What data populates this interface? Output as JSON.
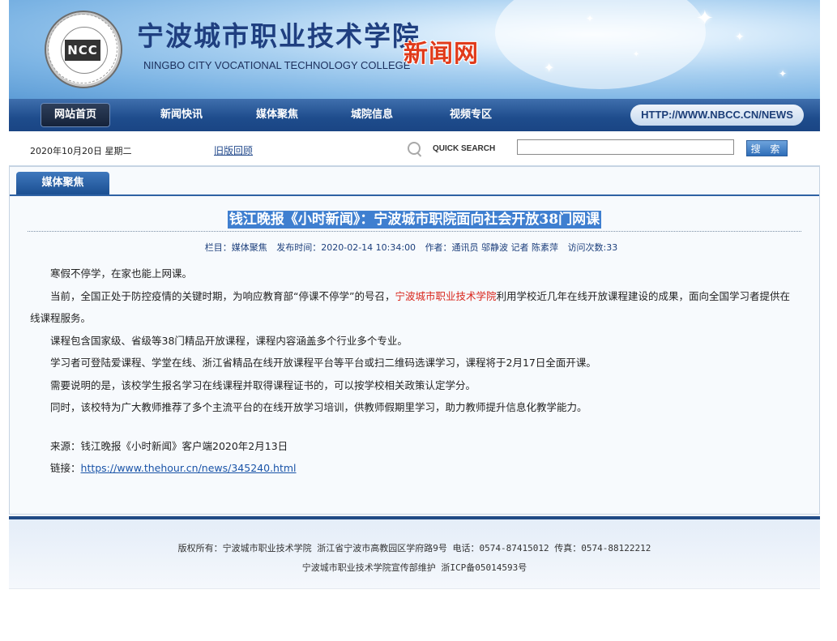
{
  "header": {
    "title_cn": "宁波城市职业技术学院",
    "title_en": "NINGBO CITY VOCATIONAL TECHNOLOGY COLLEGE",
    "site_name": "新闻网",
    "logo_text": "NCC",
    "url": "HTTP://WWW.NBCC.CN/NEWS"
  },
  "nav": {
    "items": [
      {
        "label": "网站首页"
      },
      {
        "label": "新闻快讯"
      },
      {
        "label": "媒体聚焦"
      },
      {
        "label": "城院信息"
      },
      {
        "label": "视频专区"
      }
    ]
  },
  "infobar": {
    "date": "2020年10月20日  星期二",
    "old_version": "旧版回顾",
    "quick_search": "QUICK SEARCH",
    "search_value": "",
    "search_button": "搜 索"
  },
  "section": {
    "tab": "媒体聚焦"
  },
  "article": {
    "title": "钱江晚报《小时新闻》：宁波城市职院面向社会开放38门网课",
    "meta": {
      "column": "栏目：媒体聚焦",
      "time": "发布时间：2020-02-14 10:34:00",
      "author": "作者：通讯员 邬静波 记者 陈素萍",
      "views": "访问次数:33"
    },
    "p1": "寒假不停学，在家也能上网课。",
    "p2_before": "当前，全国正处于防控疫情的关键时期，为响应教育部“停课不停学”的号召，",
    "p2_highlight": "宁波城市职业技术学院",
    "p2_after": "利用学校近几年在线开放课程建设的成果，面向全国学习者提供在线课程服务。",
    "p3": "课程包含国家级、省级等38门精品开放课程，课程内容涵盖多个行业多个专业。",
    "p4": "学习者可登陆爱课程、学堂在线、浙江省精品在线开放课程平台等平台或扫二维码选课学习，课程将于2月17日全面开课。",
    "p5": "需要说明的是，该校学生报名学习在线课程并取得课程证书的，可以按学校相关政策认定学分。",
    "p6": "同时，该校特为广大教师推荐了多个主流平台的在线开放学习培训，供教师假期里学习，助力教师提升信息化教学能力。",
    "source": "来源：钱江晚报《小时新闻》客户端2020年2月13日",
    "link_label": "链接：",
    "link_url": "https://www.thehour.cn/news/345240.html"
  },
  "footer": {
    "line1": "版权所有：宁波城市职业技术学院 浙江省宁波市高教园区学府路9号 电话：0574-87415012 传真：0574-88122212",
    "line2": "宁波城市职业技术学院宣传部维护 浙ICP备05014593号"
  },
  "colors": {
    "nav_blue": "#1e4c8c",
    "title_highlight": "#3f7fd0",
    "accent_red": "#d9261c"
  }
}
